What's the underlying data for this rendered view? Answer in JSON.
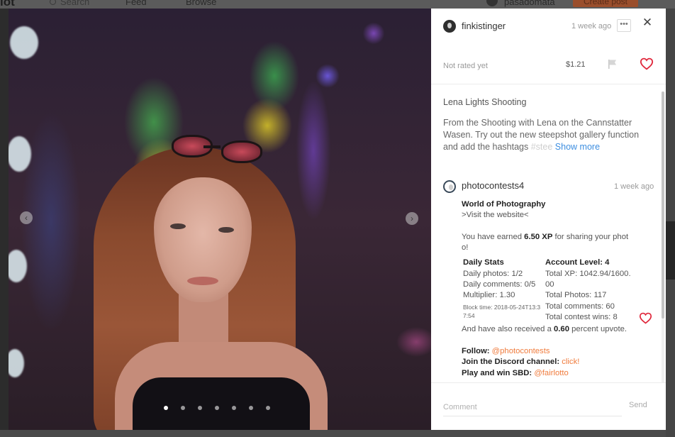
{
  "background_header": {
    "logo": "iot",
    "search_label": "Search",
    "nav_feed": "Feed",
    "nav_browse": "Browse",
    "username": "pasadomata",
    "create_post": "Create post"
  },
  "gallery": {
    "image_count": 7,
    "active_index": 0
  },
  "post": {
    "author": "finkistinger",
    "time": "1 week ago",
    "rating": "Not rated yet",
    "payout": "$1.21",
    "title": "Lena Lights Shooting",
    "body_line1": "From the Shooting with Lena on the Cannstatter",
    "body_line2": "Wasen. Try out the new steepshot gallery function",
    "body_line3": "and add the hashtags ",
    "body_fade": "#stee",
    "show_more": "Show more"
  },
  "comment": {
    "author": "photocontests4",
    "time": "1 week ago",
    "heading": "World of Photography",
    "visit": ">Visit the website<",
    "earned_prefix": "You have earned ",
    "earned_xp": "6.50 XP",
    "earned_suffix": " for sharing your phot",
    "earned_tail": "o!",
    "daily_title": "Daily Stats",
    "daily_photos": "Daily photos: 1/2",
    "daily_comments": "Daily comments: 0/5",
    "multiplier": "Multiplier: 1.30",
    "block_time_1": "Block time: 2018-05-24T13:3",
    "block_time_2": "7:54",
    "account_title": "Account Level: 4",
    "total_xp_1": "Total XP: 1042.94/1600.",
    "total_xp_2": "00",
    "total_photos": "Total Photos: 117",
    "total_comments": "Total comments: 60",
    "total_wins": "Total contest wins: 8",
    "upvote_prefix": "And have also received a ",
    "upvote_value": "0.60",
    "upvote_suffix": " percent upvote.",
    "follow_label": "Follow:",
    "follow_link": "@photocontests",
    "discord_label": "Join the Discord channel:",
    "discord_link": "click!",
    "play_label": "Play and win SBD:",
    "play_link": "@fairlotto"
  },
  "comment_input": {
    "placeholder": "Comment",
    "send": "Send"
  },
  "colors": {
    "accent_link": "#3d8ee0",
    "comment_link": "#f07b3c",
    "heart": "#e0283c"
  },
  "icons": [
    "search-icon",
    "chevron-left-icon",
    "chevron-right-icon",
    "more-icon",
    "close-icon",
    "flag-icon",
    "heart-icon"
  ]
}
